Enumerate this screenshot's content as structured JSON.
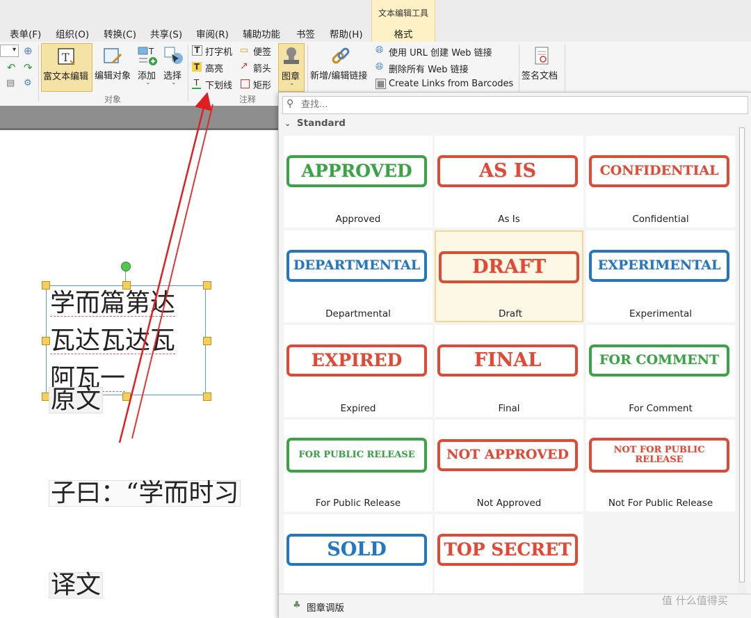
{
  "menu": {
    "items": [
      "表单(F)",
      "组织(O)",
      "转换(C)",
      "共享(S)",
      "审阅(R)",
      "辅助功能",
      "书签",
      "帮助(H)"
    ],
    "context_group": "文本编辑工具",
    "context_tab": "格式"
  },
  "ribbon": {
    "rich_text_edit": "富文本编辑",
    "edit_object": "编辑对象",
    "add": "添加",
    "select": "选择",
    "group_object": "对象",
    "typewriter": "打字机",
    "note": "便签",
    "highlight": "高亮",
    "arrow": "箭头",
    "underline": "下划线",
    "rectangle": "矩形",
    "group_comment": "注释",
    "stamp": "图章",
    "add_edit_link": "新增/编辑链接",
    "url_link": "使用 URL 创建 Web 链接",
    "remove_links": "删除所有 Web 链接",
    "barcode_links": "Create Links from Barcodes",
    "sign_document": "签名文档"
  },
  "document": {
    "line1": "学而篇第达",
    "line2": "瓦达瓦达瓦",
    "line3": "阿瓦一",
    "original_label": "原文",
    "quote_line": "子曰：“学而时习",
    "translation_label": "译文"
  },
  "stamp_panel": {
    "search_placeholder": "查找...",
    "category": "Standard",
    "stamps": [
      {
        "text": "APPROVED",
        "name": "Approved",
        "color": "#3aa346"
      },
      {
        "text": "AS IS",
        "name": "As Is",
        "color": "#e04a35"
      },
      {
        "text": "CONFIDENTIAL",
        "name": "Confidential",
        "color": "#e04a35"
      },
      {
        "text": "DEPARTMENTAL",
        "name": "Departmental",
        "color": "#2277c0"
      },
      {
        "text": "DRAFT",
        "name": "Draft",
        "color": "#e04a35"
      },
      {
        "text": "EXPERIMENTAL",
        "name": "Experimental",
        "color": "#2277c0"
      },
      {
        "text": "EXPIRED",
        "name": "Expired",
        "color": "#e04a35"
      },
      {
        "text": "FINAL",
        "name": "Final",
        "color": "#e04a35"
      },
      {
        "text": "FOR COMMENT",
        "name": "For Comment",
        "color": "#3aa346"
      },
      {
        "text": "FOR PUBLIC RELEASE",
        "name": "For Public Release",
        "color": "#3aa346"
      },
      {
        "text": "NOT APPROVED",
        "name": "Not Approved",
        "color": "#e04a35"
      },
      {
        "text": "NOT FOR PUBLIC RELEASE",
        "name": "Not For Public Release",
        "color": "#e04a35"
      },
      {
        "text": "SOLD",
        "name": "Sold",
        "color": "#2277c0"
      },
      {
        "text": "TOP SECRET",
        "name": "Top Secret",
        "color": "#e04a35"
      }
    ],
    "selected": "Draft",
    "footer": "图章调版"
  },
  "watermark": "值 什么值得买",
  "colors": {
    "annotation_arrow": "#e02020",
    "selection_handle": "#f0c040",
    "rotate_handle": "#52c552"
  }
}
